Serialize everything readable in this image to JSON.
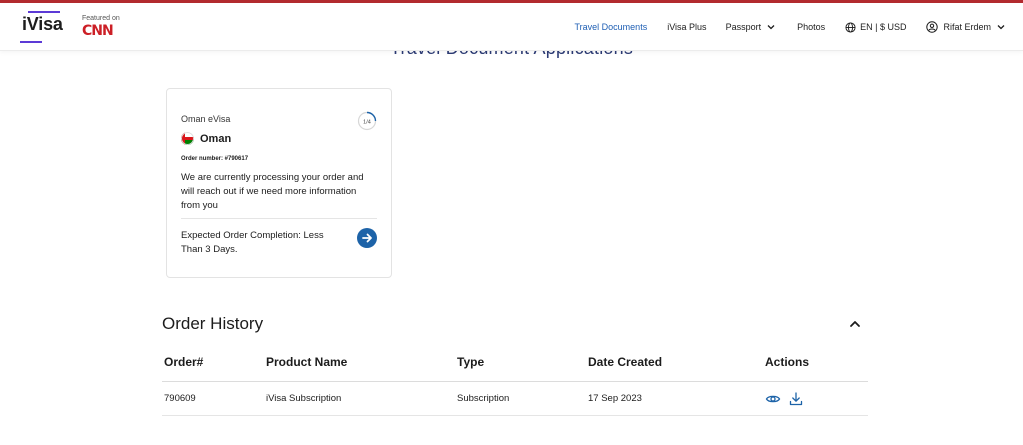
{
  "header": {
    "logo": "iVisa",
    "featured_label": "Featured on",
    "featured_brand": "CNN",
    "nav": [
      {
        "label": "Travel Documents",
        "active": true
      },
      {
        "label": "iVisa Plus"
      },
      {
        "label": "Passport",
        "icon": "chevron-down-icon"
      },
      {
        "label": "Photos"
      },
      {
        "label": "EN | $ USD",
        "icon": "globe-icon"
      },
      {
        "label": "Rifat Erdem",
        "icon": "user-circle-icon"
      }
    ]
  },
  "page": {
    "heading": "Travel Document Applications"
  },
  "order_card": {
    "title": "Oman eVisa",
    "progress": "1/4",
    "country": "Oman",
    "order_number": "Order number: #790617",
    "message": "We are currently processing your order and will reach out if we need more information from you",
    "completion": "Expected Order Completion: Less Than 3 Days."
  },
  "order_history": {
    "title": "Order History",
    "columns": [
      "Order#",
      "Product Name",
      "Type",
      "Date Created",
      "Actions"
    ],
    "rows": [
      {
        "order": "790609",
        "product": "iVisa Subscription",
        "type": "Subscription",
        "date": "17 Sep 2023",
        "actions": [
          "eye-icon",
          "download-icon"
        ]
      }
    ]
  },
  "colors": {
    "accent": "#1f5fb4",
    "brand_purple": "#5c3ad6",
    "heading": "#2b3a74",
    "top_border": "#b22a2e",
    "cnn_red": "#cc1f26"
  }
}
